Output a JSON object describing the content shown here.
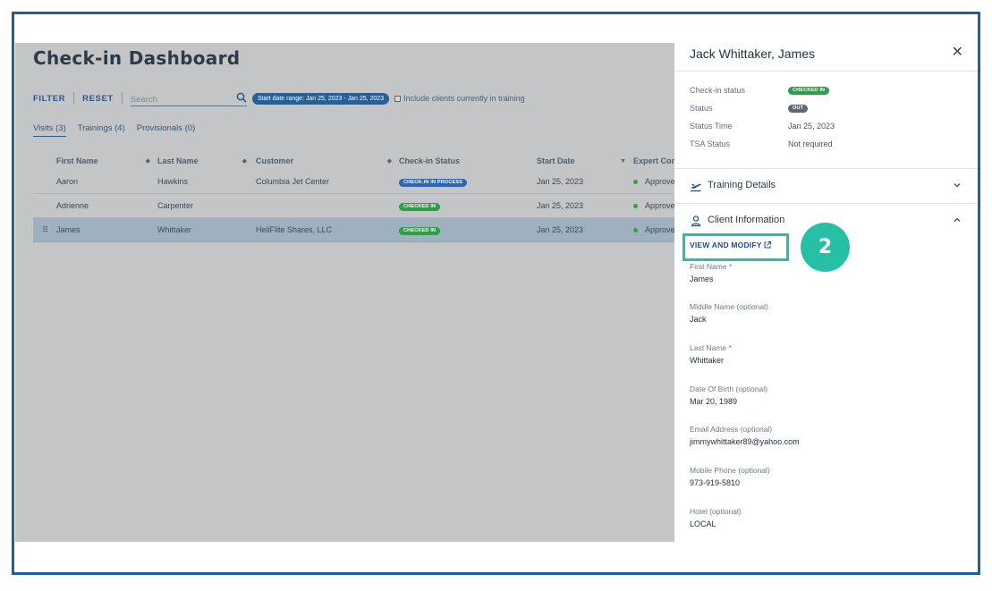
{
  "dashboard": {
    "title": "Check-in Dashboard",
    "toolbar": {
      "filter_label": "FILTER",
      "reset_label": "RESET",
      "search_placeholder": "Search",
      "date_range_chip": "Start date range: Jan 25, 2023 - Jan 25, 2023",
      "include_training_label": "Include clients currently in training",
      "include_training_checked": false
    },
    "tabs": [
      {
        "label": "Visits (3)",
        "active": true
      },
      {
        "label": "Trainings (4)",
        "active": false
      },
      {
        "label": "Provisionals (0)",
        "active": false
      }
    ],
    "columns": [
      "First Name",
      "Last Name",
      "Customer",
      "Check-in Status",
      "Start Date",
      "Expert Con"
    ],
    "rows": [
      {
        "first": "Aaron",
        "last": "Hawkins",
        "customer": "Columbia Jet Center",
        "status": "CHECK-IN IN PROCESS",
        "status_color": "#2f66b3",
        "start": "Jan 25, 2023",
        "expert": "Approve",
        "selected": false
      },
      {
        "first": "Adrienne",
        "last": "Carpenter",
        "customer": "",
        "status": "CHECKED IN",
        "status_color": "#2e9e48",
        "start": "Jan 25, 2023",
        "expert": "Approve",
        "selected": false
      },
      {
        "first": "James",
        "last": "Whittaker",
        "customer": "HeliFlite Shares, LLC",
        "status": "CHECKED IN",
        "status_color": "#2e9e48",
        "start": "Jan 25, 2023",
        "expert": "Approve",
        "selected": true
      }
    ]
  },
  "panel": {
    "title": "Jack Whittaker, James",
    "status": {
      "checkin_status_label": "Check-in status",
      "checkin_status_value": "CHECKED IN",
      "status_label": "Status",
      "status_value": "OUT",
      "status_time_label": "Status Time",
      "status_time_value": "Jan 25, 2023",
      "tsa_label": "TSA Status",
      "tsa_value": "Not required"
    },
    "training_details_label": "Training Details",
    "client_information_label": "Client Information",
    "view_modify_label": "VIEW AND MODIFY",
    "step_number": "2",
    "fields": [
      {
        "label": "First Name *",
        "value": "James"
      },
      {
        "label": "Middle Name (optional)",
        "value": "Jack"
      },
      {
        "label": "Last Name *",
        "value": "Whittaker"
      },
      {
        "label": "Date Of Birth (optional)",
        "value": "Mar 20, 1989"
      },
      {
        "label": "Email Address (optional)",
        "value": "jimmywhittaker89@yahoo.com"
      },
      {
        "label": "Mobile Phone (optional)",
        "value": "973-919-5810"
      },
      {
        "label": "Hotel (optional)",
        "value": "LOCAL"
      }
    ]
  },
  "colors": {
    "brand_blue": "#2a5f94",
    "highlight_teal": "#25c0a6",
    "frame_blue": "#1a5fa8"
  }
}
